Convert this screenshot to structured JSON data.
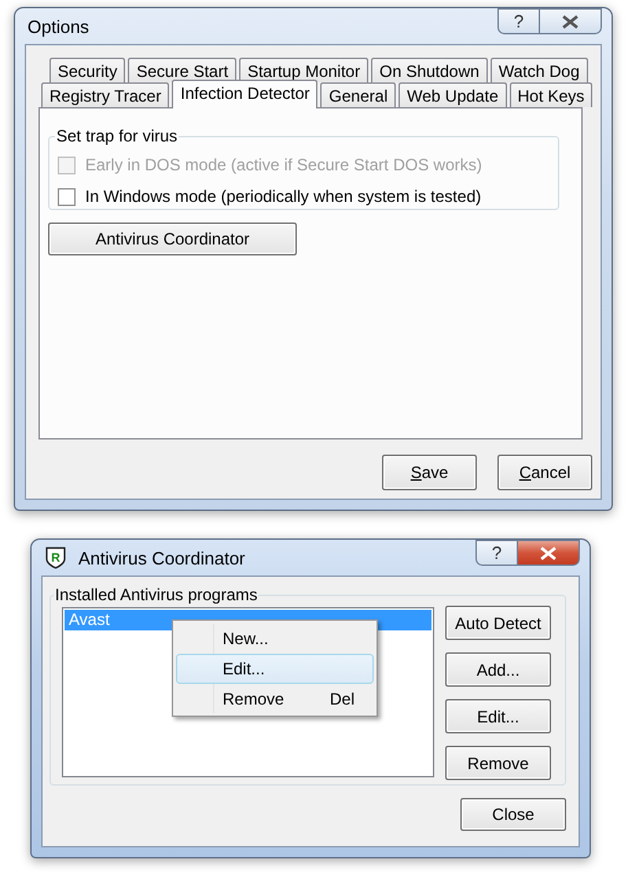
{
  "options_window": {
    "title": "Options",
    "active": false,
    "help": "?",
    "tab_rows": [
      [
        {
          "label": "Security",
          "selected": false
        },
        {
          "label": "Secure Start",
          "selected": false
        },
        {
          "label": "Startup Monitor",
          "selected": false
        },
        {
          "label": "On Shutdown",
          "selected": false
        },
        {
          "label": "Watch Dog",
          "selected": false
        }
      ],
      [
        {
          "label": "Registry Tracer",
          "selected": false
        },
        {
          "label": "Infection Detector",
          "selected": true
        },
        {
          "label": "General",
          "selected": false
        },
        {
          "label": "Web Update",
          "selected": false
        },
        {
          "label": "Hot Keys",
          "selected": false
        }
      ]
    ],
    "group": {
      "title": "Set trap for virus",
      "options": [
        {
          "label": "Early in DOS mode (active if Secure Start DOS works)",
          "checked": false,
          "disabled": true
        },
        {
          "label": "In Windows mode (periodically when system is tested)",
          "checked": false,
          "disabled": false
        }
      ]
    },
    "coordinator_button": "Antivirus Coordinator",
    "footer_buttons": [
      {
        "label": "Save",
        "access_key_underlined": true
      },
      {
        "label": "Cancel",
        "access_key_underlined": true
      }
    ]
  },
  "coordinator_window": {
    "title": "Antivirus Coordinator",
    "active": true,
    "icon_letter": "R",
    "help": "?",
    "group_title": "Installed Antivirus programs",
    "programs": [
      {
        "label": "Avast",
        "selected": true
      }
    ],
    "side_buttons": [
      "Auto Detect",
      "Add...",
      "Edit...",
      "Remove"
    ],
    "context_menu": [
      {
        "label": "New...",
        "selected": false
      },
      {
        "label": "Edit...",
        "selected": true
      },
      {
        "label": "Remove",
        "shortcut": "Del",
        "selected": false
      }
    ],
    "close_button": "Close"
  }
}
